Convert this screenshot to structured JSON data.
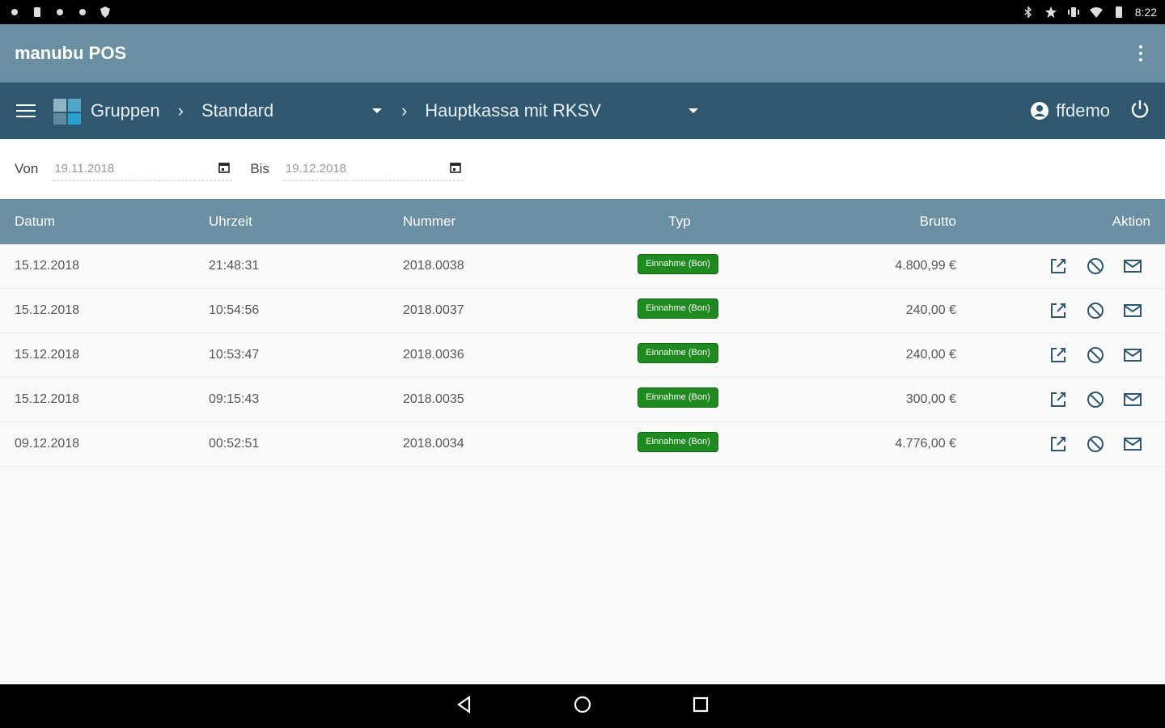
{
  "status_bar": {
    "time": "8:22",
    "left_icons": [
      "gear-icon",
      "sim-icon",
      "gear-icon",
      "gear-icon",
      "shield-icon"
    ],
    "right_icons": [
      "bluetooth-icon",
      "star-icon",
      "vibrate-icon",
      "wifi-icon",
      "battery-icon"
    ]
  },
  "app_bar": {
    "title": "manubu POS",
    "menu_icon": "more-vert-icon"
  },
  "nav": {
    "groups_label": "Gruppen",
    "group_selected": "Standard",
    "register_selected": "Hauptkassa mit RKSV",
    "username": "ffdemo"
  },
  "filter": {
    "from_label": "Von",
    "from_value": "19.11.2018",
    "to_label": "Bis",
    "to_value": "19.12.2018"
  },
  "table": {
    "columns": {
      "date": "Datum",
      "time": "Uhrzeit",
      "number": "Nummer",
      "type": "Typ",
      "gross": "Brutto",
      "action": "Aktion"
    },
    "rows": [
      {
        "date": "15.12.2018",
        "time": "21:48:31",
        "number": "2018.0038",
        "type": "Einnahme (Bon)",
        "gross": "4.800,99 €"
      },
      {
        "date": "15.12.2018",
        "time": "10:54:56",
        "number": "2018.0037",
        "type": "Einnahme (Bon)",
        "gross": "240,00 €"
      },
      {
        "date": "15.12.2018",
        "time": "10:53:47",
        "number": "2018.0036",
        "type": "Einnahme (Bon)",
        "gross": "240,00 €"
      },
      {
        "date": "15.12.2018",
        "time": "09:15:43",
        "number": "2018.0035",
        "type": "Einnahme (Bon)",
        "gross": "300,00 €"
      },
      {
        "date": "09.12.2018",
        "time": "00:52:51",
        "number": "2018.0034",
        "type": "Einnahme (Bon)",
        "gross": "4.776,00 €"
      }
    ]
  },
  "colors": {
    "app_bar": "#6a8fa2",
    "nav_bar": "#2f5870",
    "badge": "#1f8a1f",
    "action_icon": "#2f5870"
  }
}
